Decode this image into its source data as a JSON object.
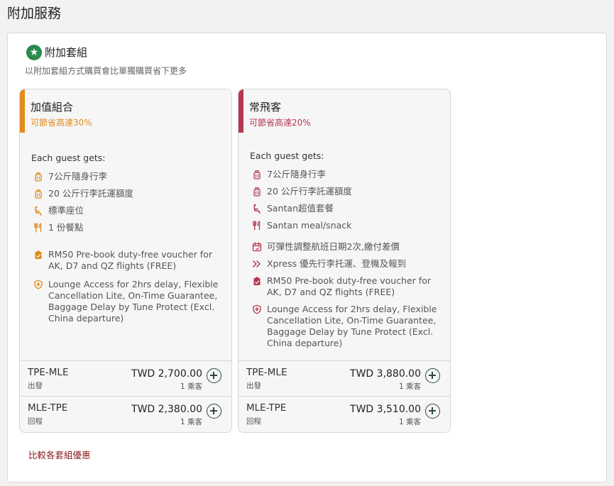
{
  "page": {
    "title": "附加服務"
  },
  "section": {
    "title": "附加套組",
    "subtitle": "以附加套組方式購買會比單獨購買省下更多"
  },
  "cards": [
    {
      "name": "加值組合",
      "savings": "可節省高達30%",
      "accent_color": "#e08a1e",
      "gets_label": "Each guest gets:",
      "features": [
        {
          "icon": "luggage-icon",
          "text": "7公斤隨身行李"
        },
        {
          "icon": "luggage-icon",
          "text": "20 公斤行李託運額度"
        },
        {
          "icon": "seat-icon",
          "text": "標準座位"
        },
        {
          "icon": "meal-icon",
          "text": "1 份餐點"
        },
        {
          "icon": "voucher-icon",
          "text": "RM50 Pre-book duty-free voucher for AK, D7 and QZ flights (FREE)"
        },
        {
          "icon": "shield-icon",
          "text": "Lounge Access for 2hrs delay, Flexible Cancellation Lite, On-Time Guarantee, Baggage Delay by Tune Protect (Excl. China departure)"
        }
      ],
      "prices": [
        {
          "route": "TPE-MLE",
          "direction": "出發",
          "price": "TWD 2,700.00",
          "pax": "1 乘客"
        },
        {
          "route": "MLE-TPE",
          "direction": "回程",
          "price": "TWD 2,380.00",
          "pax": "1 乘客"
        }
      ]
    },
    {
      "name": "常飛客",
      "savings": "可節省高達20%",
      "accent_color": "#b5384f",
      "gets_label": "Each guest gets:",
      "features": [
        {
          "icon": "luggage-icon",
          "text": "7公斤隨身行李"
        },
        {
          "icon": "luggage-icon",
          "text": "20 公斤行李託運額度"
        },
        {
          "icon": "seat-icon",
          "text": "Santan超值套餐"
        },
        {
          "icon": "meal-icon",
          "text": "Santan meal/snack"
        },
        {
          "icon": "calendar-icon",
          "text": "可彈性調整航班日期2次,繳付差價"
        },
        {
          "icon": "chevrons-icon",
          "text": "Xpress 優先行李托運、登機及報到"
        },
        {
          "icon": "voucher-icon",
          "text": "RM50 Pre-book duty-free voucher for AK, D7 and QZ flights (FREE)"
        },
        {
          "icon": "shield-icon",
          "text": "Lounge Access for 2hrs delay, Flexible Cancellation Lite, On-Time Guarantee, Baggage Delay by Tune Protect (Excl. China departure)"
        }
      ],
      "prices": [
        {
          "route": "TPE-MLE",
          "direction": "出發",
          "price": "TWD 3,880.00",
          "pax": "1 乘客"
        },
        {
          "route": "MLE-TPE",
          "direction": "回程",
          "price": "TWD 3,510.00",
          "pax": "1 乘客"
        }
      ]
    }
  ],
  "compare_link": "比較各套組優惠"
}
